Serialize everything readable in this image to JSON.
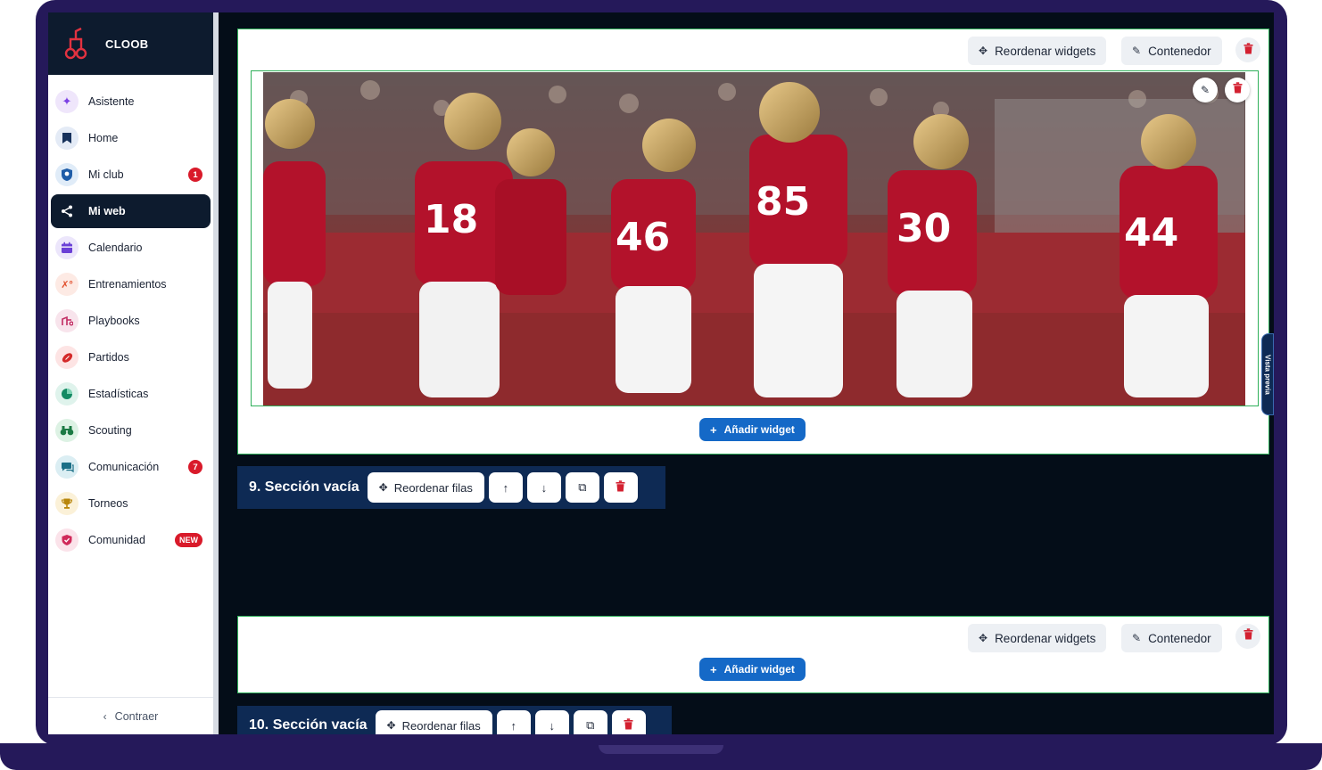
{
  "brand": {
    "name": "CLOOB"
  },
  "nav": {
    "items": [
      {
        "label": "Asistente",
        "icon": "sparkles-icon",
        "badge": ""
      },
      {
        "label": "Home",
        "icon": "bookmark-icon",
        "badge": ""
      },
      {
        "label": "Mi club",
        "icon": "club-icon",
        "badge": "1"
      },
      {
        "label": "Mi web",
        "icon": "share-icon",
        "badge": "",
        "active": true
      },
      {
        "label": "Calendario",
        "icon": "calendar-icon",
        "badge": ""
      },
      {
        "label": "Entrenamientos",
        "icon": "drills-icon",
        "badge": ""
      },
      {
        "label": "Playbooks",
        "icon": "playbook-icon",
        "badge": ""
      },
      {
        "label": "Partidos",
        "icon": "football-icon",
        "badge": ""
      },
      {
        "label": "Estadísticas",
        "icon": "pie-chart-icon",
        "badge": ""
      },
      {
        "label": "Scouting",
        "icon": "binoculars-icon",
        "badge": ""
      },
      {
        "label": "Comunicación",
        "icon": "chat-icon",
        "badge": "7"
      },
      {
        "label": "Torneos",
        "icon": "trophy-icon",
        "badge": ""
      },
      {
        "label": "Comunidad",
        "icon": "community-icon",
        "badge": "NEW"
      }
    ],
    "collapse_label": "Contraer"
  },
  "sections": {
    "top_container": {
      "reorder_widgets_label": "Reordenar widgets",
      "container_label": "Contenedor",
      "add_widget_label": "Añadir widget"
    },
    "row9": {
      "title": "9. Sección vacía",
      "reorder_rows_label": "Reordenar filas"
    },
    "bottom_container": {
      "reorder_widgets_label": "Reordenar widgets",
      "container_label": "Contenedor",
      "add_widget_label": "Añadir widget"
    },
    "row10": {
      "title": "10. Sección vacía",
      "reorder_rows_label": "Reordenar filas"
    }
  },
  "side_tab": {
    "label": "Vista previa"
  },
  "colors": {
    "accent": "#1569c7",
    "sidebar_active": "#0d1b2e",
    "danger": "#d32030",
    "outline": "#2fb05a",
    "team_red": "#b3122b"
  }
}
